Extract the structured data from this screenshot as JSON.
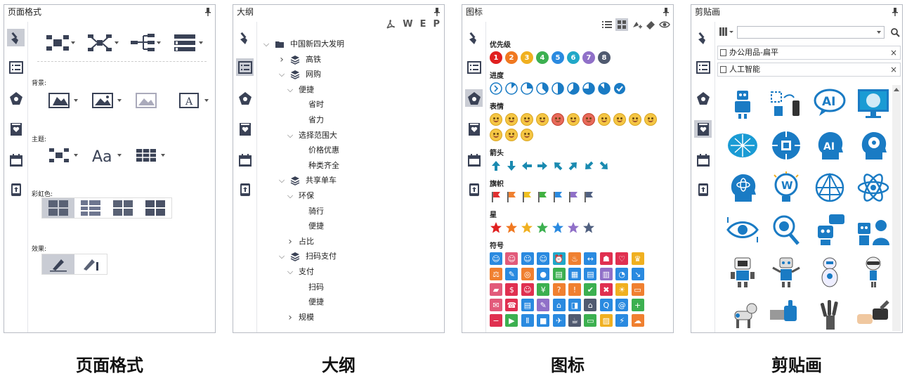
{
  "colors": {
    "accent": "#1a7bc4",
    "active_side": "#c9ccd4",
    "border": "#b8bcc4"
  },
  "panels": {
    "page_format": {
      "title": "页面格式",
      "labels": {
        "background": "背景:",
        "theme": "主题:",
        "rainbow": "彩虹色:",
        "effect": "效果:"
      },
      "caption": "页面格式"
    },
    "outline": {
      "title": "大纲",
      "toolbar": [
        "W",
        "E",
        "P"
      ],
      "tree": [
        {
          "label": "中国新四大发明",
          "level": 0,
          "expand": "open",
          "icon": "folder"
        },
        {
          "label": "高铁",
          "level": 1,
          "expand": "closed",
          "icon": "layers"
        },
        {
          "label": "网购",
          "level": 1,
          "expand": "open",
          "icon": "layers"
        },
        {
          "label": "便捷",
          "level": 2,
          "expand": "open",
          "icon": ""
        },
        {
          "label": "省时",
          "level": 3,
          "expand": "",
          "icon": ""
        },
        {
          "label": "省力",
          "level": 3,
          "expand": "",
          "icon": ""
        },
        {
          "label": "选择范围大",
          "level": 2,
          "expand": "open",
          "icon": ""
        },
        {
          "label": "价格优惠",
          "level": 3,
          "expand": "",
          "icon": ""
        },
        {
          "label": "种类齐全",
          "level": 3,
          "expand": "",
          "icon": ""
        },
        {
          "label": "共享单车",
          "level": 1,
          "expand": "open",
          "icon": "layers"
        },
        {
          "label": "环保",
          "level": 2,
          "expand": "open",
          "icon": ""
        },
        {
          "label": "骑行",
          "level": 3,
          "expand": "",
          "icon": ""
        },
        {
          "label": "便捷",
          "level": 3,
          "expand": "",
          "icon": ""
        },
        {
          "label": "占比",
          "level": 2,
          "expand": "closed",
          "icon": ""
        },
        {
          "label": "扫码支付",
          "level": 1,
          "expand": "open",
          "icon": "layers"
        },
        {
          "label": "支付",
          "level": 2,
          "expand": "open",
          "icon": ""
        },
        {
          "label": "扫码",
          "level": 3,
          "expand": "",
          "icon": ""
        },
        {
          "label": "便捷",
          "level": 3,
          "expand": "",
          "icon": ""
        },
        {
          "label": "规模",
          "level": 2,
          "expand": "closed",
          "icon": ""
        }
      ],
      "caption": "大纲"
    },
    "icons": {
      "title": "图标",
      "sections": {
        "priority": "优先级",
        "progress": "进度",
        "emotion": "表情",
        "arrow": "箭头",
        "flag": "旗帜",
        "star": "星",
        "symbol": "符号"
      },
      "priority_numbers": [
        "1",
        "2",
        "3",
        "4",
        "5",
        "6",
        "7",
        "8"
      ],
      "priority_colors": [
        "#e02020",
        "#f07820",
        "#f0b020",
        "#3cb050",
        "#2a8ae0",
        "#20a8c8",
        "#9070c8",
        "#505a70"
      ],
      "flag_colors": [
        "#e03030",
        "#f08030",
        "#f0c020",
        "#40b040",
        "#2a8ae0",
        "#9070c8",
        "#506080"
      ],
      "star_colors": [
        "#e02020",
        "#f07820",
        "#f0b020",
        "#3cb050",
        "#2a8ae0",
        "#9070c8",
        "#506080"
      ],
      "caption": "图标"
    },
    "clipart": {
      "title": "剪贴画",
      "search_value": "",
      "tags": [
        "办公用品-扁平",
        "人工智能"
      ],
      "tile_labels": {
        "ai_text": "AI"
      },
      "caption": "剪贴画"
    }
  }
}
